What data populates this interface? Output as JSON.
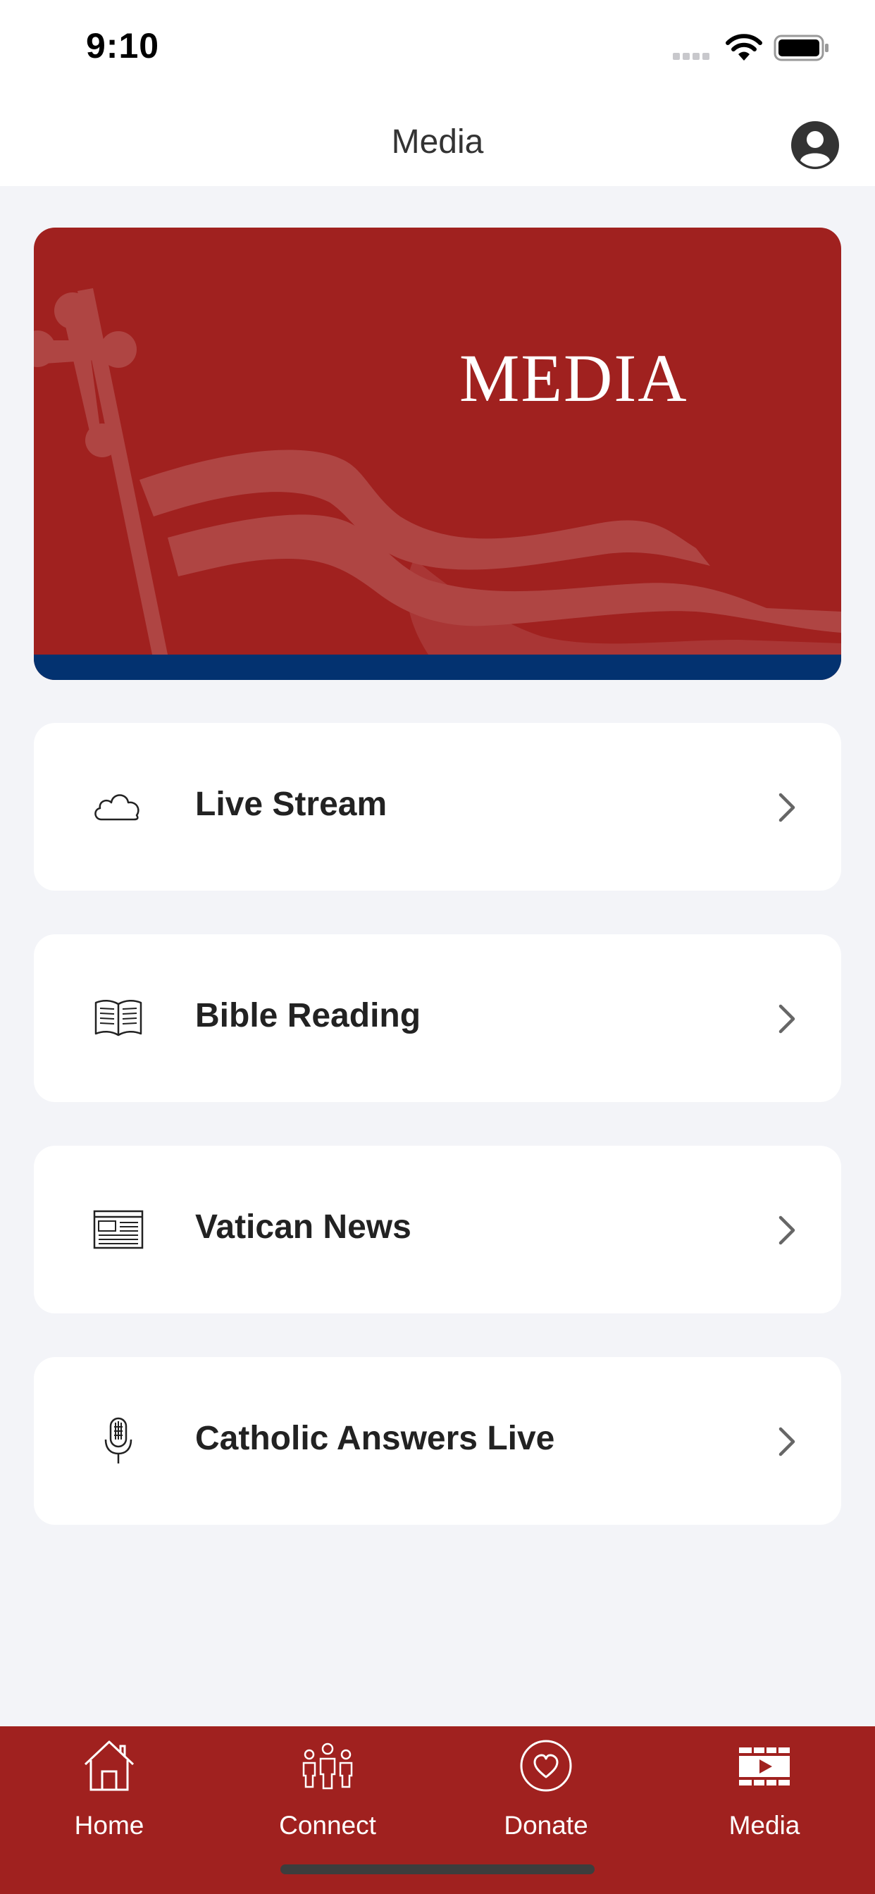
{
  "status_bar": {
    "time": "9:10"
  },
  "header": {
    "title": "Media"
  },
  "banner": {
    "title": "MEDIA"
  },
  "menu": [
    {
      "label": "Live Stream",
      "icon": "cloud-icon"
    },
    {
      "label": "Bible Reading",
      "icon": "open-book-icon"
    },
    {
      "label": "Vatican News",
      "icon": "newspaper-icon"
    },
    {
      "label": "Catholic Answers Live",
      "icon": "microphone-icon"
    }
  ],
  "tabs": [
    {
      "label": "Home",
      "icon": "home-icon"
    },
    {
      "label": "Connect",
      "icon": "people-icon"
    },
    {
      "label": "Donate",
      "icon": "heart-icon"
    },
    {
      "label": "Media",
      "icon": "film-icon"
    }
  ],
  "colors": {
    "brand_red": "#A0211F",
    "navy_stripe": "#033270",
    "background": "#F3F4F8"
  }
}
